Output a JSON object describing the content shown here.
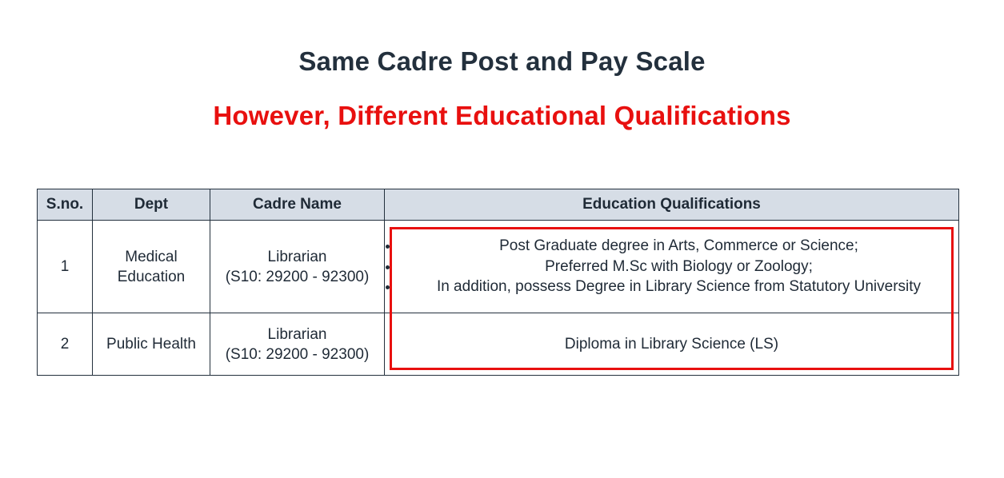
{
  "title": "Same Cadre Post and Pay Scale",
  "subtitle": "However, Different Educational Qualifications",
  "accent_color": "#e8100f",
  "table": {
    "headers": [
      "S.no.",
      "Dept",
      "Cadre Name",
      "Education Qualifications"
    ],
    "rows": [
      {
        "sno": "1",
        "dept_line1": "Medical",
        "dept_line2": "Education",
        "cadre_line1": "Librarian",
        "cadre_line2": "(S10: 29200 - 92300)",
        "qualifications": [
          "Post Graduate degree in Arts, Commerce or Science;",
          "Preferred M.Sc with Biology or Zoology;",
          "In addition, possess Degree in Library Science from Statutory University"
        ]
      },
      {
        "sno": "2",
        "dept": "Public Health",
        "cadre_line1": "Librarian",
        "cadre_line2": "(S10: 29200 - 92300)",
        "qualification": "Diploma in Library Science (LS)"
      }
    ]
  }
}
